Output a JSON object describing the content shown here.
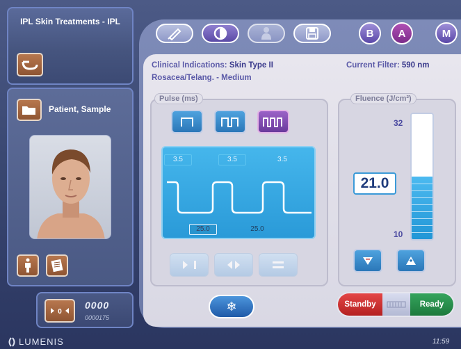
{
  "treatment": {
    "title": "IPL Skin Treatments - IPL",
    "home_icon": "sink-handpiece-icon"
  },
  "patient": {
    "name": "Patient, Sample",
    "folder_icon": "folder-icon",
    "portrait_icon": "patient-portrait",
    "buttons": [
      "body-map-icon",
      "patient-chart-icon"
    ]
  },
  "counter": {
    "main": "0000",
    "sub": "0000175",
    "reset_icon": "counter-reset-icon"
  },
  "brand": {
    "logo": "LUMENIS",
    "clock": "11:59"
  },
  "toolbar": {
    "tabs": [
      {
        "name": "handpiece-tab",
        "icon": "pen-icon",
        "active": false
      },
      {
        "name": "timer-tab",
        "icon": "clock-icon",
        "active": true
      },
      {
        "name": "patient-tab",
        "icon": "person-icon",
        "active": false
      },
      {
        "name": "save-tab",
        "icon": "floppy-disk-icon",
        "active": false
      }
    ],
    "modes": [
      {
        "label": "B",
        "active": false
      },
      {
        "label": "A",
        "active": true
      },
      {
        "label": "M",
        "active": false
      }
    ]
  },
  "indications": {
    "clinical_label": "Clinical Indications:",
    "clinical_value": "Skin Type II",
    "line2": "Rosacea/Telang. - Medium",
    "filter_label": "Current Filter:",
    "filter_value": "590 nm"
  },
  "pulse": {
    "label": "Pulse (ms)",
    "pulse_counts": [
      1,
      2,
      3
    ],
    "selected_pulse_count": 3,
    "widths": [
      "3.5",
      "3.5",
      "3.5"
    ],
    "delays": [
      "25.0",
      "25.0"
    ],
    "controls": [
      "expand-icon",
      "contract-icon",
      "equal-icon"
    ]
  },
  "fluence": {
    "label": "Fluence (J/cm²)",
    "value": "21.0",
    "max": "32",
    "min": "10",
    "level_fraction": 0.5,
    "decrease_icon": "decrease-arrow-icon",
    "increase_icon": "increase-arrow-icon"
  },
  "cooling": {
    "icon": "snowflake-icon",
    "glyph": "❄"
  },
  "state": {
    "standby": "Standby",
    "ready": "Ready",
    "active": "standby"
  },
  "colors": {
    "accent_purple": "#6a3a9c",
    "accent_blue": "#2b77b8",
    "standby_red": "#b42020",
    "ready_green": "#1d7a3c"
  }
}
